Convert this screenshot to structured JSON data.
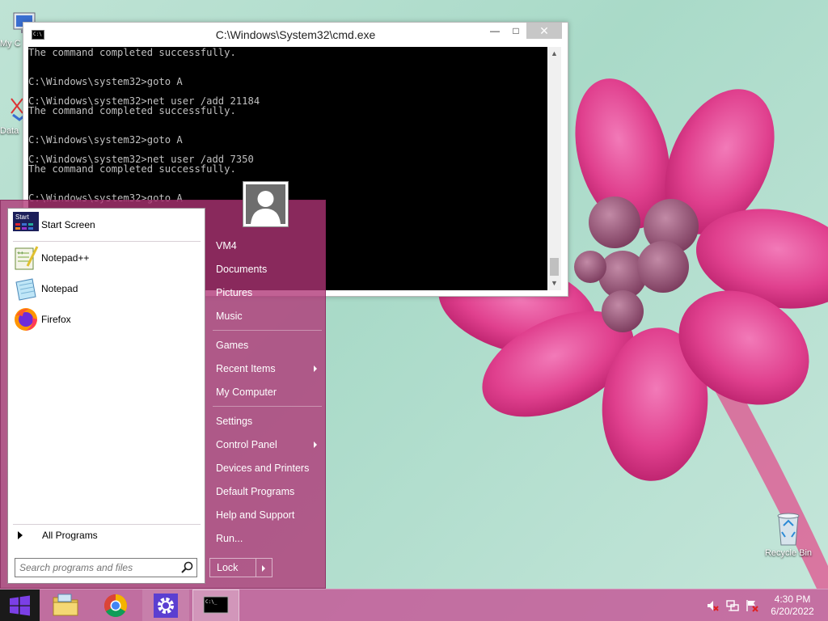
{
  "desktop": {
    "icons": [
      {
        "name": "my-computer",
        "label": "My C"
      },
      {
        "name": "data",
        "label": "Data"
      },
      {
        "name": "recycle-bin",
        "label": "Recycle Bin"
      }
    ]
  },
  "cmd": {
    "title": "C:\\Windows\\System32\\cmd.exe",
    "lines": [
      "The command completed successfully.",
      "",
      "",
      "C:\\Windows\\system32>goto A",
      "",
      "C:\\Windows\\system32>net user /add 21184",
      "The command completed successfully.",
      "",
      "",
      "C:\\Windows\\system32>goto A",
      "",
      "C:\\Windows\\system32>net user /add 7350",
      "The command completed successfully.",
      "",
      "",
      "C:\\Windows\\system32>goto A"
    ]
  },
  "start_menu": {
    "left_items": [
      {
        "label": "Start Screen",
        "icon": "start-screen-icon",
        "icon_text": "Start"
      },
      {
        "label": "Notepad++",
        "icon": "notepad-plus-plus-icon"
      },
      {
        "label": "Notepad",
        "icon": "notepad-icon"
      },
      {
        "label": "Firefox",
        "icon": "firefox-icon"
      }
    ],
    "all_programs": "All Programs",
    "search_placeholder": "Search programs and files",
    "right_items": [
      {
        "label": "VM4",
        "has_arrow": false
      },
      {
        "label": "Documents",
        "has_arrow": false
      },
      {
        "label": "Pictures",
        "has_arrow": false
      },
      {
        "label": "Music",
        "has_arrow": false
      },
      {
        "label": "Games",
        "has_arrow": false
      },
      {
        "label": "Recent Items",
        "has_arrow": true
      },
      {
        "label": "My Computer",
        "has_arrow": false
      },
      {
        "label": "Settings",
        "has_arrow": false
      },
      {
        "label": "Control Panel",
        "has_arrow": true
      },
      {
        "label": "Devices and Printers",
        "has_arrow": false
      },
      {
        "label": "Default Programs",
        "has_arrow": false
      },
      {
        "label": "Help and Support",
        "has_arrow": false
      },
      {
        "label": "Run...",
        "has_arrow": false
      }
    ],
    "lock_label": "Lock"
  },
  "taskbar": {
    "apps": [
      "start-button",
      "file-explorer",
      "chrome",
      "settings",
      "command-prompt"
    ],
    "tray": [
      "volume-muted-icon",
      "network-icon",
      "action-center-flag-icon"
    ],
    "clock": {
      "time": "4:30 PM",
      "date": "6/20/2022"
    }
  },
  "colors": {
    "start_menu_bg": "#b03476",
    "taskbar_bg": "#c45696",
    "console_bg": "#000000",
    "console_text": "#c0c0c0"
  }
}
